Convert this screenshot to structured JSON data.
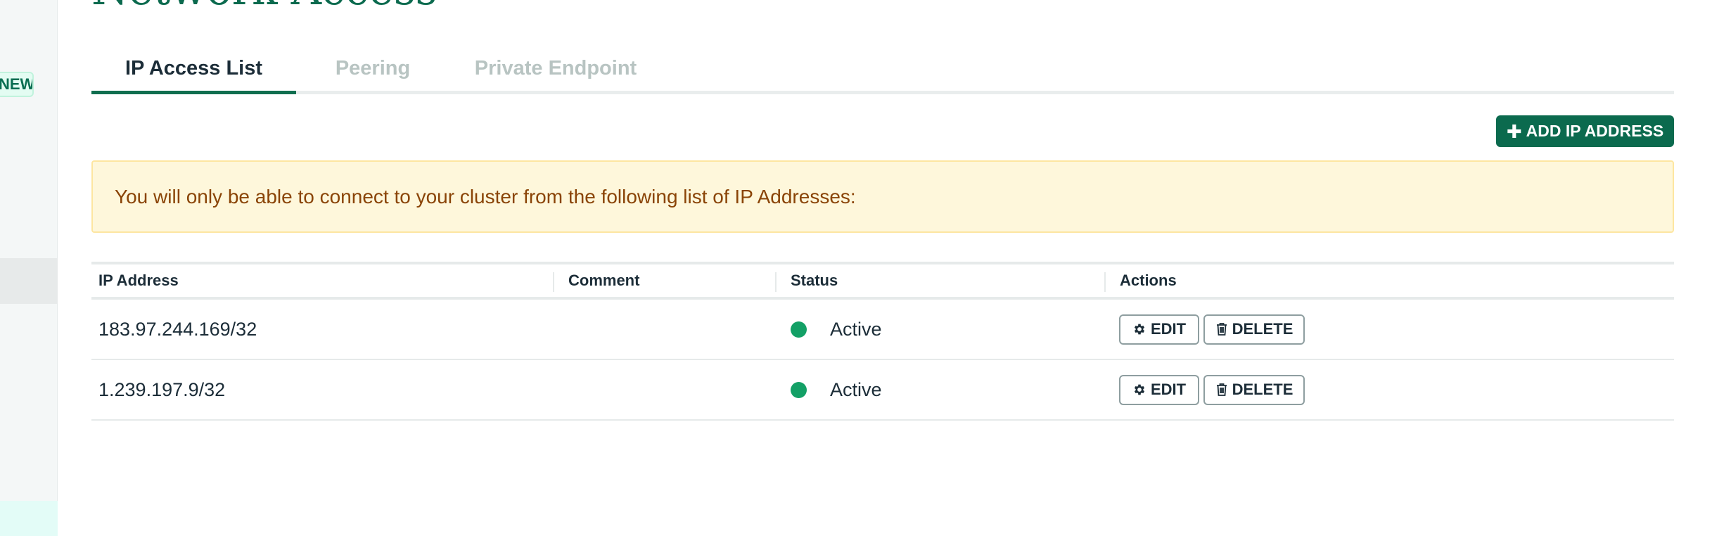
{
  "page": {
    "heading": "Network Access"
  },
  "sidebar": {
    "badge": "NEW"
  },
  "tabs": [
    {
      "label": "IP Access List",
      "active": true
    },
    {
      "label": "Peering",
      "active": false
    },
    {
      "label": "Private Endpoint",
      "active": false
    }
  ],
  "toolbar": {
    "add_ip_label": "ADD IP ADDRESS",
    "add_ip_icon": "plus-icon"
  },
  "banner": {
    "text": "You will only be able to connect to your cluster from the following list of IP Addresses:"
  },
  "table": {
    "columns": [
      "IP Address",
      "Comment",
      "Status",
      "Actions"
    ],
    "rows": [
      {
        "ip": "183.97.244.169/32",
        "comment": "",
        "status": "Active"
      },
      {
        "ip": "1.239.197.9/32",
        "comment": "",
        "status": "Active"
      }
    ],
    "actions": {
      "edit_label": "EDIT",
      "edit_icon": "gear-icon",
      "delete_label": "DELETE",
      "delete_icon": "trash-icon"
    }
  },
  "colors": {
    "brand": "#0b6a4e",
    "status_active": "#13a066",
    "banner_bg": "#fef7db",
    "banner_text": "#8a4407"
  }
}
